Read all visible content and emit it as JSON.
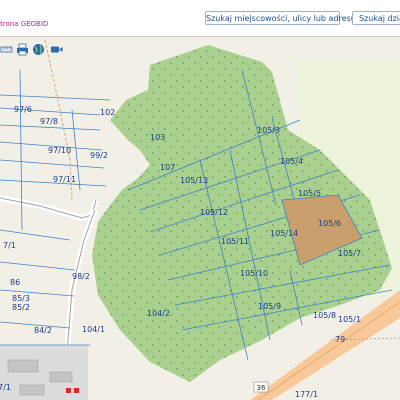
{
  "header": {
    "brand": "trona GEOBID",
    "search_address_label": "Szukaj miejscowości, ulicy lub adresu",
    "search_parcel_label": "Szukaj działki"
  },
  "toolbar": {
    "tools": [
      {
        "icon": "measure-icon"
      },
      {
        "icon": "print-icon"
      },
      {
        "icon": "globe-icon"
      },
      {
        "icon": "camera-icon"
      }
    ]
  },
  "map": {
    "colors": {
      "forest": "#a9d08e",
      "selected_parcel": "#c9a06c",
      "boundary": "#3f82c8",
      "road": "#f7c998"
    },
    "parcel_labels": [
      "97/6",
      "97/8",
      "102",
      "103",
      "105/3",
      "97/10",
      "99/2",
      "105/4",
      "97/11",
      "107",
      "105/13",
      "105/5",
      "105/12",
      "105/6",
      "105/14",
      "105/11",
      "105/7",
      "7/1",
      "86",
      "98/2",
      "105/10",
      "85/3",
      "85/2",
      "104/2",
      "105/9",
      "105/8",
      "105/1",
      "84/2",
      "104/1",
      "79",
      "7/1",
      "36",
      "177/1"
    ],
    "selected_parcel": "105/6",
    "road_number": "36"
  }
}
